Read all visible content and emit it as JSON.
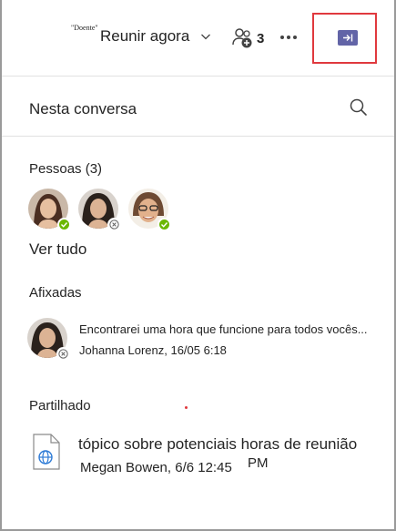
{
  "header": {
    "badge": "\"Doente\"",
    "meet_now": "Reunir agora",
    "participants_count": "3"
  },
  "search": {
    "title": "Nesta conversa"
  },
  "people": {
    "title": "Pessoas (3)",
    "view_all": "Ver tudo",
    "avatars": [
      {
        "status": "available"
      },
      {
        "status": "offline"
      },
      {
        "status": "available"
      }
    ]
  },
  "pinned": {
    "title": "Afixadas",
    "item": {
      "message": "Encontrarei uma hora que funcione para todos vocês...",
      "meta": "Johanna Lorenz, 16/05 6:18"
    }
  },
  "shared": {
    "title": "Partilhado",
    "item": {
      "title": "tópico sobre potenciais horas de reunião",
      "meta": "Megan Bowen, 6/6 12:45",
      "meta_suffix": "PM"
    }
  },
  "colors": {
    "accent": "#6264a7",
    "available": "#6bb700",
    "highlight": "#e0393e"
  }
}
